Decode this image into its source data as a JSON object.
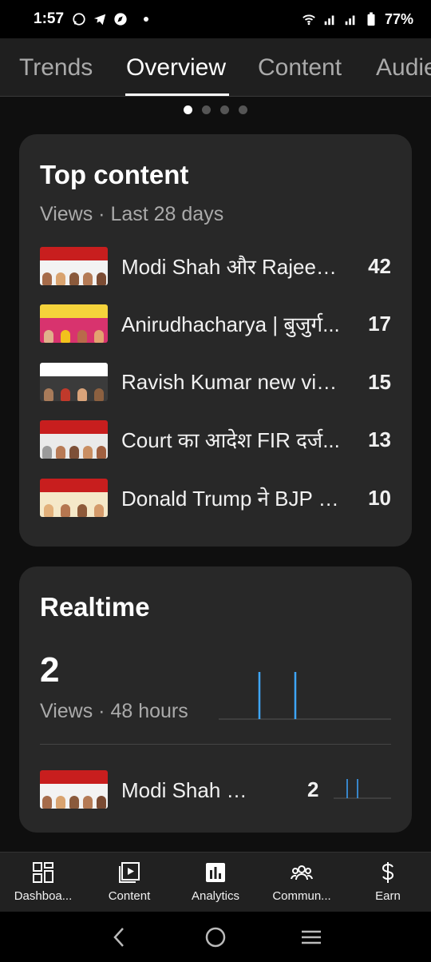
{
  "status_bar": {
    "time": "1:57",
    "battery": "77%"
  },
  "tabs": [
    {
      "label": "Trends"
    },
    {
      "label": "Overview"
    },
    {
      "label": "Content"
    },
    {
      "label": "Audience"
    }
  ],
  "pager": {
    "count": 4,
    "active_index": 0
  },
  "top_content": {
    "title": "Top content",
    "subtitle": "Views · Last 28 days",
    "items": [
      {
        "title": "Modi Shah और Rajeev Kumar...",
        "count": "42"
      },
      {
        "title": "Anirudhacharya | बुजुर्ग...",
        "count": "17"
      },
      {
        "title": "Ravish Kumar new video...",
        "count": "15"
      },
      {
        "title": "Court का आदेश FIR दर्ज...",
        "count": "13"
      },
      {
        "title": "Donald Trump ने BJP को...",
        "count": "10"
      }
    ]
  },
  "realtime": {
    "title": "Realtime",
    "views_value": "2",
    "views_caption": "Views · 48 hours",
    "top_item": {
      "title": "Modi Shah और Rajeev Kumar...",
      "count": "2"
    }
  },
  "bottom_nav": [
    {
      "label": "Dashboa...",
      "icon": "dashboard-icon"
    },
    {
      "label": "Content",
      "icon": "content-icon"
    },
    {
      "label": "Analytics",
      "icon": "analytics-icon"
    },
    {
      "label": "Commun...",
      "icon": "community-icon"
    },
    {
      "label": "Earn",
      "icon": "dollar-icon"
    }
  ],
  "colors": {
    "accent": "#3ea6ff",
    "card": "#282828",
    "background": "#0f0f0f"
  }
}
